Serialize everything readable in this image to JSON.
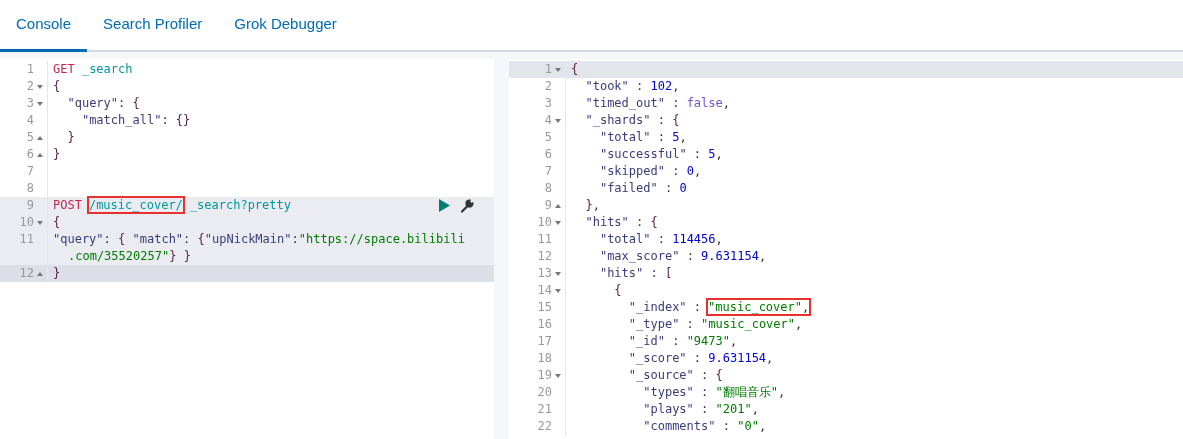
{
  "tabs": [
    {
      "label": "Console",
      "selected": true
    },
    {
      "label": "Search Profiler",
      "selected": false
    },
    {
      "label": "Grok Debugger",
      "selected": false
    }
  ],
  "request_editor": {
    "lines": [
      {
        "number": "1",
        "kind": "request",
        "fold_start": false,
        "fold_end": false,
        "highlighted": false,
        "active": false,
        "text": "GET _search"
      },
      {
        "number": "2",
        "kind": "json",
        "fold_start": true,
        "fold_end": false,
        "highlighted": false,
        "active": false,
        "text": "{"
      },
      {
        "number": "3",
        "kind": "json",
        "fold_start": true,
        "fold_end": false,
        "highlighted": false,
        "active": false,
        "text": "  \"query\": {"
      },
      {
        "number": "4",
        "kind": "json",
        "fold_start": false,
        "fold_end": false,
        "highlighted": false,
        "active": false,
        "text": "    \"match_all\": {}"
      },
      {
        "number": "5",
        "kind": "json",
        "fold_start": false,
        "fold_end": true,
        "highlighted": false,
        "active": false,
        "text": "  }"
      },
      {
        "number": "6",
        "kind": "json",
        "fold_start": false,
        "fold_end": true,
        "highlighted": false,
        "active": false,
        "text": "}"
      },
      {
        "number": "7",
        "kind": "json",
        "fold_start": false,
        "fold_end": false,
        "highlighted": false,
        "active": false
      },
      {
        "number": "8",
        "kind": "json",
        "fold_start": false,
        "fold_end": false,
        "highlighted": false,
        "active": false
      },
      {
        "number": "9",
        "kind": "request",
        "fold_start": false,
        "fold_end": false,
        "highlighted": true,
        "active": false,
        "actions": true,
        "parts": [
          {
            "text": "POST",
            "boxed": false
          },
          {
            "text": "/music_cover/",
            "boxed": true
          },
          {
            "text": "_search?pretty",
            "boxed": false
          }
        ]
      },
      {
        "number": "10",
        "kind": "json",
        "fold_start": true,
        "fold_end": false,
        "highlighted": true,
        "active": false,
        "text": "{"
      },
      {
        "number": "11",
        "kind": "json",
        "fold_start": false,
        "fold_end": false,
        "highlighted": true,
        "active": false,
        "text": "\"query\": { \"match\": {\"upNickMain\":\"https://space.bilibili",
        "wrapped": ".com/35520257\"} }"
      },
      {
        "number": "12",
        "kind": "json",
        "fold_start": false,
        "fold_end": true,
        "highlighted": true,
        "active": true,
        "text": "}"
      }
    ]
  },
  "response_viewer": {
    "lines": [
      {
        "number": "1",
        "kind": "json",
        "fold_start": true,
        "fold_end": false,
        "highlighted": false,
        "active": true,
        "text": "{"
      },
      {
        "number": "2",
        "kind": "json",
        "fold_start": false,
        "fold_end": false,
        "highlighted": false,
        "active": false,
        "text": "  \"took\" : 102,"
      },
      {
        "number": "3",
        "kind": "json",
        "fold_start": false,
        "fold_end": false,
        "highlighted": false,
        "active": false,
        "text": "  \"timed_out\" : false,"
      },
      {
        "number": "4",
        "kind": "json",
        "fold_start": true,
        "fold_end": false,
        "highlighted": false,
        "active": false,
        "text": "  \"_shards\" : {"
      },
      {
        "number": "5",
        "kind": "json",
        "fold_start": false,
        "fold_end": false,
        "highlighted": false,
        "active": false,
        "text": "    \"total\" : 5,"
      },
      {
        "number": "6",
        "kind": "json",
        "fold_start": false,
        "fold_end": false,
        "highlighted": false,
        "active": false,
        "text": "    \"successful\" : 5,"
      },
      {
        "number": "7",
        "kind": "json",
        "fold_start": false,
        "fold_end": false,
        "highlighted": false,
        "active": false,
        "text": "    \"skipped\" : 0,"
      },
      {
        "number": "8",
        "kind": "json",
        "fold_start": false,
        "fold_end": false,
        "highlighted": false,
        "active": false,
        "text": "    \"failed\" : 0"
      },
      {
        "number": "9",
        "kind": "json",
        "fold_start": false,
        "fold_end": true,
        "highlighted": false,
        "active": false,
        "text": "  },"
      },
      {
        "number": "10",
        "kind": "json",
        "fold_start": true,
        "fold_end": false,
        "highlighted": false,
        "active": false,
        "text": "  \"hits\" : {"
      },
      {
        "number": "11",
        "kind": "json",
        "fold_start": false,
        "fold_end": false,
        "highlighted": false,
        "active": false,
        "text": "    \"total\" : 114456,"
      },
      {
        "number": "12",
        "kind": "json",
        "fold_start": false,
        "fold_end": false,
        "highlighted": false,
        "active": false,
        "text": "    \"max_score\" : 9.631154,"
      },
      {
        "number": "13",
        "kind": "json",
        "fold_start": true,
        "fold_end": false,
        "highlighted": false,
        "active": false,
        "text": "    \"hits\" : ["
      },
      {
        "number": "14",
        "kind": "json",
        "fold_start": true,
        "fold_end": false,
        "highlighted": false,
        "active": false,
        "text": "      {"
      },
      {
        "number": "15",
        "kind": "json",
        "fold_start": false,
        "fold_end": false,
        "highlighted": false,
        "active": false,
        "parts": [
          {
            "text": "        \"_index\" :",
            "boxed": false
          },
          {
            "text": "\"music_cover\",",
            "boxed": true
          }
        ]
      },
      {
        "number": "16",
        "kind": "json",
        "fold_start": false,
        "fold_end": false,
        "highlighted": false,
        "active": false,
        "text": "        \"_type\" : \"music_cover\","
      },
      {
        "number": "17",
        "kind": "json",
        "fold_start": false,
        "fold_end": false,
        "highlighted": false,
        "active": false,
        "text": "        \"_id\" : \"9473\","
      },
      {
        "number": "18",
        "kind": "json",
        "fold_start": false,
        "fold_end": false,
        "highlighted": false,
        "active": false,
        "text": "        \"_score\" : 9.631154,"
      },
      {
        "number": "19",
        "kind": "json",
        "fold_start": true,
        "fold_end": false,
        "highlighted": false,
        "active": false,
        "text": "        \"_source\" : {"
      },
      {
        "number": "20",
        "kind": "json",
        "fold_start": false,
        "fold_end": false,
        "highlighted": false,
        "active": false,
        "text": "          \"types\" : \"翻唱音乐\","
      },
      {
        "number": "21",
        "kind": "json",
        "fold_start": false,
        "fold_end": false,
        "highlighted": false,
        "active": false,
        "text": "          \"plays\" : \"201\","
      },
      {
        "number": "22",
        "kind": "json",
        "fold_start": false,
        "fold_end": false,
        "highlighted": false,
        "active": false,
        "text": "          \"comments\" : \"0\","
      }
    ]
  }
}
